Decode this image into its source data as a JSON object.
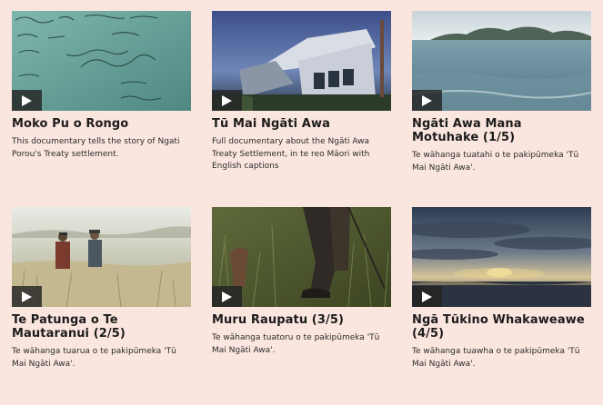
{
  "videos": [
    {
      "title": "Moko Pu o Rongo",
      "description": "This documentary tells the story of Ngati Porou's Treaty settlement."
    },
    {
      "title": "Tū Mai Ngāti Awa",
      "description": "Full documentary about the Ngāti Awa Treaty Settlement, in te reo Māori with English captions"
    },
    {
      "title": "Ngāti Awa Mana Motuhake (1/5)",
      "description": "Te wāhanga tuatahi o te pakipūmeka 'Tū Mai Ngāti Awa'."
    },
    {
      "title": "Te Patunga o Te Mautaranui (2/5)",
      "description": "Te wāhanga tuarua o te pakipūmeka 'Tū Mai Ngāti Awa'."
    },
    {
      "title": "Muru Raupatu (3/5)",
      "description": "Te wāhanga tuatoru o te pakipūmeka 'Tū Mai Ngāti Awa'."
    },
    {
      "title": "Ngā Tūkino Whakaweawe (4/5)",
      "description": "Te wāhanga tuawha o te pakipūmeka 'Tū Mai Ngāti Awa'."
    }
  ],
  "icons": {
    "play": "play-icon"
  },
  "colors": {
    "background": "#fbe6df",
    "play_overlay": "#232323"
  }
}
